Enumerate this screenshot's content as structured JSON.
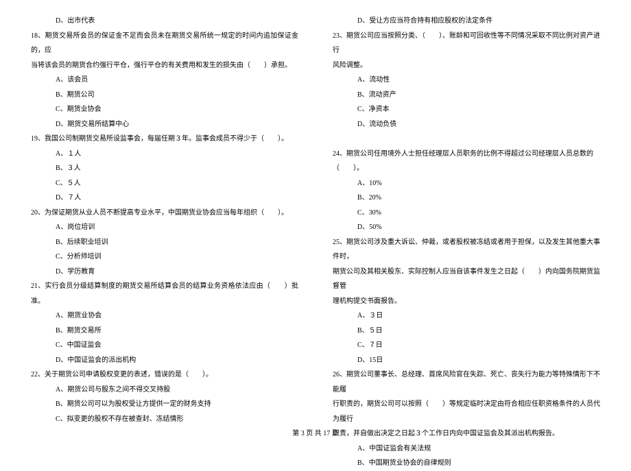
{
  "left": {
    "q17_d": "D、出市代表",
    "q18": "18、期货交易所会员的保证金不足而会员未在期货交易所统一规定的时间内追加保证金的，应",
    "q18_cont": "当将该会员的期货合约强行平仓，强行平仓的有关费用和发生的损失由（　　）承担。",
    "q18_a": "A、该会员",
    "q18_b": "B、期货公司",
    "q18_c": "C、期货业协会",
    "q18_d": "D、期货交易所结算中心",
    "q19": "19、我国公司制期货交易所设监事会，每届任期３年。监事会成员不得少于（　　）。",
    "q19_a": "A、１人",
    "q19_b": "B、３人",
    "q19_c": "C、５人",
    "q19_d": "D、７人",
    "q20": "20、为保证期货从业人员不断提高专业水平，中国期货业协会应当每年组织（　　）。",
    "q20_a": "A、岗位培训",
    "q20_b": "B、后续职业培训",
    "q20_c": "C、分析师培训",
    "q20_d": "D、学历教育",
    "q21": "21、实行会员分级结算制度的期货交易所结算会员的结算业务资格依法应由（　　）批准。",
    "q21_a": "A、期货业协会",
    "q21_b": "B、期货交易所",
    "q21_c": "C、中国证监会",
    "q21_d": "D、中国证监会的派出机构",
    "q22": "22、关于期货公司申请股权变更的表述，错误的是（　　）。",
    "q22_a": "A、期货公司与股东之间不得交叉持股",
    "q22_b": "B、期货公司可以为股权受让方提供一定的财务支持",
    "q22_c": "C、拟变更的股权不存在被查封、冻结情形"
  },
  "right": {
    "q22_d": "D、受让方应当符合持有相应股权的法定条件",
    "q23": "23、期货公司应当按照分类、（　　）、账龄和可回收性等不同情况采取不同比例对资产进行",
    "q23_cont": "风险调整。",
    "q23_a": "A、流动性",
    "q23_b": "B、流动资产",
    "q23_c": "C、净资本",
    "q23_d": "D、流动负债",
    "blank": "　",
    "q24": "24、期货公司任用境外人士担任经理层人员职务的比例不得超过公司经理层人员总数的",
    "q24_cont": "（　　）。",
    "q24_a": "A、10%",
    "q24_b": "B、20%",
    "q24_c": "C、30%",
    "q24_d": "D、50%",
    "q25": "25、期货公司涉及重大诉讼、仲裁，或者股权被冻结或者用于担保，以及发生其他重大事件时，",
    "q25_cont1": "期货公司及其相关股东、实际控制人应当自该事件发生之日起（　　）内向国务院期货监督管",
    "q25_cont2": "理机构提交书面报告。",
    "q25_a": "A、３日",
    "q25_b": "B、５日",
    "q25_c": "C、７日",
    "q25_d": "D、15日",
    "q26": "26、期货公司董事长、总经理、首席风险官在失踪、死亡、丧失行为能力等特殊情形下不能履",
    "q26_cont1": "行职责的，期货公司可以按照（　　）等规定临时决定由符合相应任职资格条件的人员代为履行",
    "q26_cont2": "职责，并自做出决定之日起３个工作日内向中国证监会及其派出机构报告。",
    "q26_a": "A、中国证监会有关法规",
    "q26_b": "B、中国期货业协会的自律规则"
  },
  "footer": "第 3 页 共 17 页"
}
